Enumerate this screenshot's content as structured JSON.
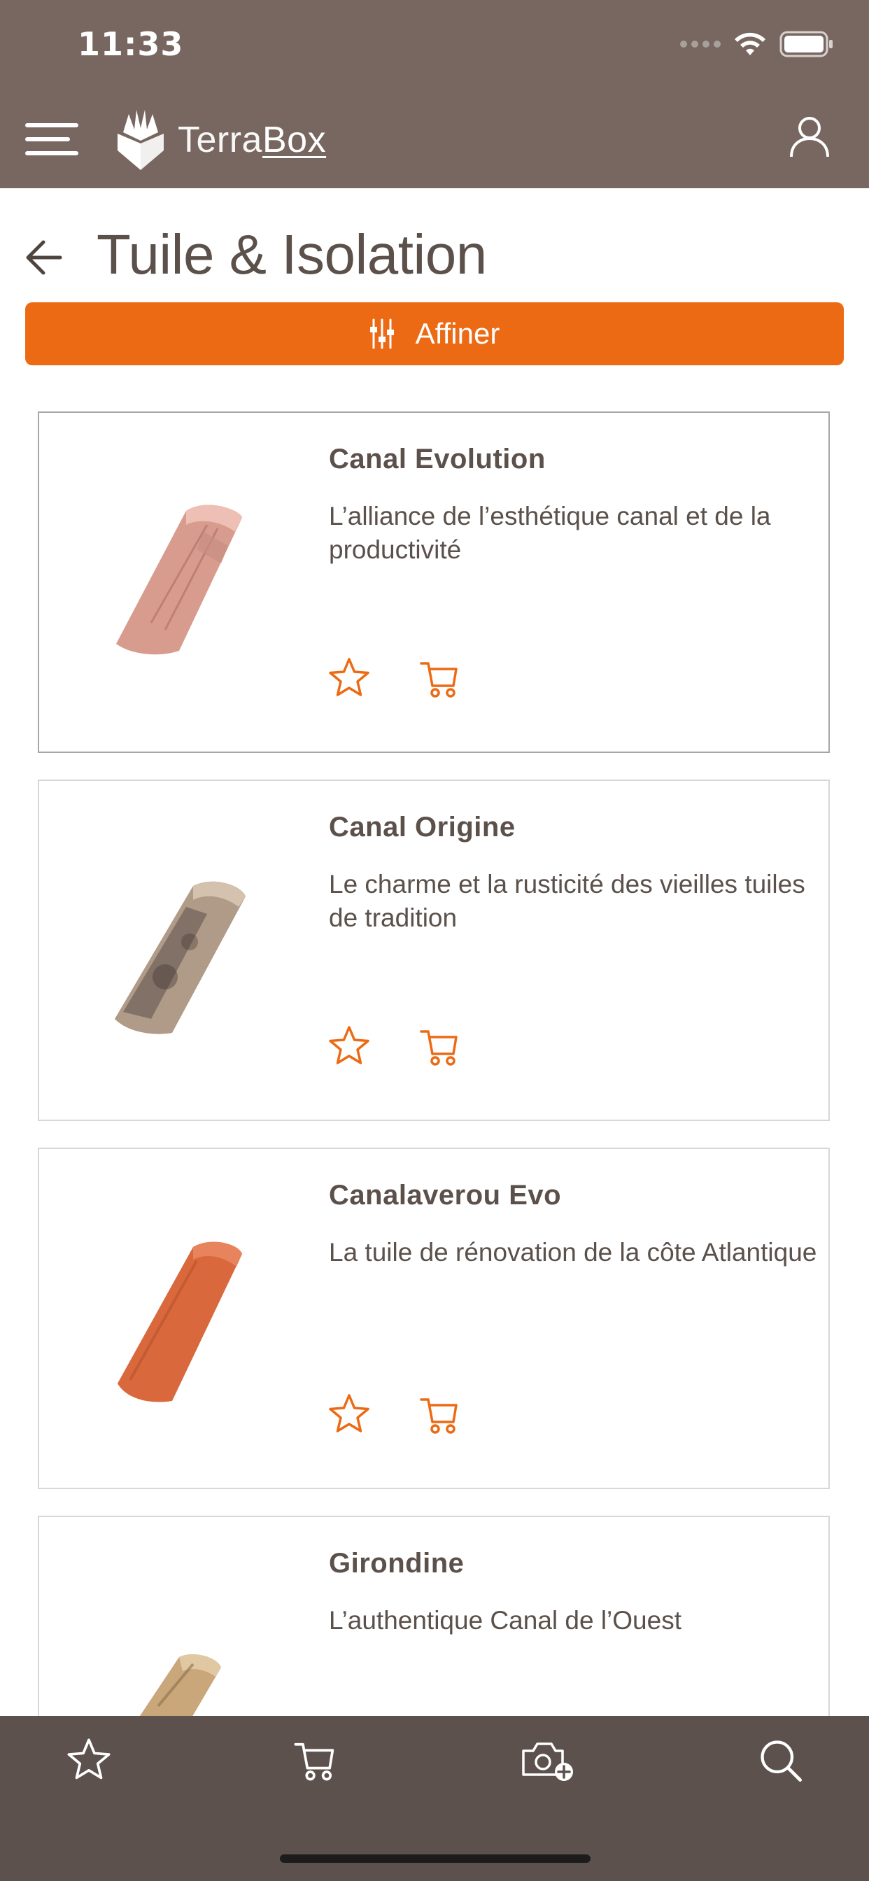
{
  "status_bar": {
    "time": "11:33"
  },
  "header": {
    "logo_text_light": "Terra",
    "logo_text_bold": "Box"
  },
  "page": {
    "title": "Tuile & Isolation",
    "filter_button_label": "Affiner"
  },
  "products": [
    {
      "name": "Canal Evolution",
      "description": "L’alliance de l’esthétique canal et de la productivité",
      "color": "#d8988a"
    },
    {
      "name": "Canal Origine",
      "description": "Le charme et la rusticité des vieilles tuiles de tradition",
      "color": "#8a786c"
    },
    {
      "name": "Canalaverou Evo",
      "description": "La tuile de rénovation de la côte Atlantique",
      "color": "#d7683f"
    },
    {
      "name": "Girondine",
      "description": "L’authentique Canal de l’Ouest",
      "color": "#c9a77a"
    }
  ],
  "bottom_nav": [
    "star-icon",
    "cart-icon",
    "camera-add-icon",
    "search-icon"
  ],
  "colors": {
    "header": "#786760",
    "accent": "#ec6a14",
    "bottom_nav": "#5c514c",
    "text": "#5b504a"
  }
}
